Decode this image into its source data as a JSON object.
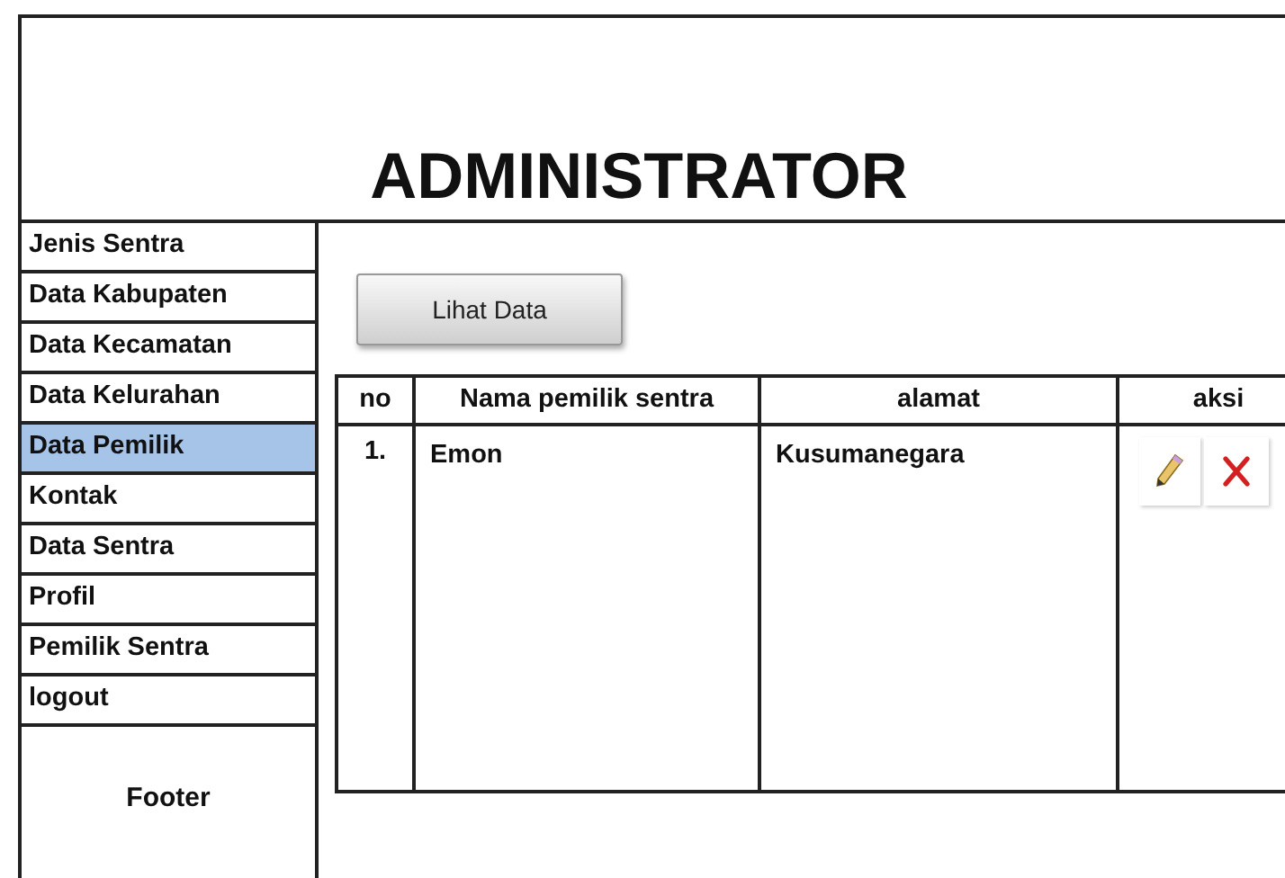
{
  "header": {
    "title": "ADMINISTRATOR"
  },
  "sidebar": {
    "items": [
      {
        "label": "Jenis Sentra",
        "selected": false
      },
      {
        "label": "Data Kabupaten",
        "selected": false
      },
      {
        "label": "Data Kecamatan",
        "selected": false
      },
      {
        "label": "Data Kelurahan",
        "selected": false
      },
      {
        "label": "Data Pemilik",
        "selected": true
      },
      {
        "label": "Kontak",
        "selected": false
      },
      {
        "label": "Data Sentra",
        "selected": false
      },
      {
        "label": "Profil",
        "selected": false
      },
      {
        "label": "Pemilik Sentra",
        "selected": false
      },
      {
        "label": "logout",
        "selected": false
      }
    ],
    "footer": "Footer"
  },
  "content": {
    "button": "Lihat Data",
    "table": {
      "columns": [
        "no",
        "Nama pemilik sentra",
        "alamat",
        "aksi"
      ],
      "rows": [
        {
          "no": "1.",
          "nama": "Emon",
          "alamat": "Kusumanegara"
        }
      ]
    }
  }
}
